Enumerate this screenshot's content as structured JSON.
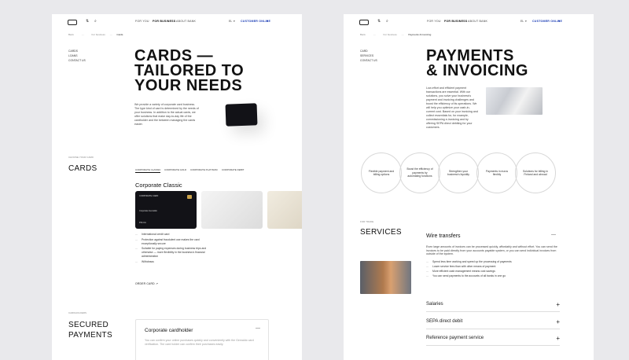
{
  "header": {
    "nav": [
      "FOR YOU",
      "FOR BUSINESS",
      "ABOUT BANK"
    ],
    "lang": "EL",
    "cta": "CUSTOMER ONLINE"
  },
  "cards_page": {
    "breadcrumb": [
      "Bank",
      "For business",
      "Cards"
    ],
    "sidebar": [
      "CARDS",
      "LOANS",
      "CONTACT US"
    ],
    "title": "CARDS — TAILORED TO YOUR NEEDS",
    "title_lines": [
      "CARDS —",
      "TAILORED TO",
      "YOUR NEEDS"
    ],
    "intro": "We provide a variety of corporate card business. The type kind of card is determined by the needs of your business. In addition to the actual cards, we offer solutions that make day-to-day life of the cardholder and the between managing the cards easier.",
    "section_kicker": "CHOOSE YOUR CARD",
    "section_title": "CARDS",
    "tabs": [
      "CORPORATE CLASSIC",
      "CORPORATE GOLD",
      "CORPORATE PLATINUM",
      "CORPORATE DEBIT"
    ],
    "active_tab": 0,
    "card_name": "Corporate Classic",
    "card_text": [
      "CORPORATE CARD",
      "Corporate Gemaldo",
      "PIN-CA"
    ],
    "features": [
      "International credit card",
      "Protection against fraudulent use makes the card exceptionally secure",
      "Suitable for paying expenses during business trips and otherwise — more flexibility in the business's financial administration",
      "Withdraws"
    ],
    "order_link": "ORDER CARD",
    "secure_kicker": "CARDHOLDERS",
    "secure_title_lines": [
      "SECURED",
      "PAYMENTS"
    ],
    "cardholder_box_title": "Corporate cardholder",
    "cardholder_box_text": "You can confirm your online purchases quickly and conveniently with the Gemaldo card verification. The card holder can confirm their purchases easily."
  },
  "payments_page": {
    "breadcrumb": [
      "Bank",
      "For business",
      "Payments & Invoicing"
    ],
    "sidebar": [
      "CARD",
      "SERVICES",
      "CONTACT US"
    ],
    "title_lines": [
      "PAYMENTS",
      "& INVOICING"
    ],
    "intro": "Low-effort and efficient payment transactions are essential. With our solutions, you solve your business's payment and invoicing challenges and boost the efficiency of its operations. We will help you optimize your cash-in-current cost. Based on your invoicing and collect essentials for, for example, commissioning e-invoicing and by offering SEPA direct debiting for your customers.",
    "benefits": [
      "Flexible payment and billing options",
      "Boost the efficiency of payments by automating functions",
      "Strengthen your business's liquidity",
      "Payments in euros flexibly",
      "Solutions for billing in Finland and abroad"
    ],
    "services_kicker": "FOR TRADE",
    "services_title": "SERVICES",
    "wire_title": "Wire transfers",
    "wire_text": "Even large amounts of invoices can be processed quickly, affordably and without effort. You can send the invoices to be paid directly from your accounts payable system, or you can send individual invoices from outside of the system.",
    "wire_bullets": [
      "Spend less time working and speed up the processing of payments",
      "Lower service fees than with other means of payment",
      "More efficient cash management means cost savings",
      "You can send payments to the accounts of all banks in one go"
    ],
    "accordion": [
      "Salaries",
      "SEPA direct debit",
      "Reference payment service"
    ]
  },
  "colors": {
    "accent": "#1a3cb5",
    "card_black": "#121217",
    "bg": "#e9e9ec"
  }
}
